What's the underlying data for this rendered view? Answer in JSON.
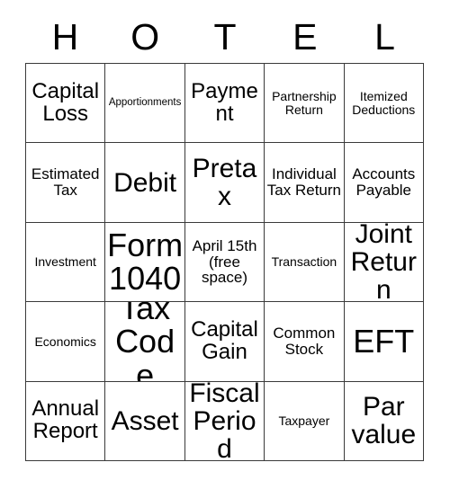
{
  "card": {
    "header_letters": [
      "H",
      "O",
      "T",
      "E",
      "L"
    ],
    "free_space_index": 12,
    "colors": {
      "border": "#3a3a3a",
      "background": "#ffffff",
      "text": "#000000"
    },
    "cells": [
      {
        "text": "Capital Loss",
        "size": "xl"
      },
      {
        "text": "Apportionments",
        "size": "xs"
      },
      {
        "text": "Payment",
        "size": "xl"
      },
      {
        "text": "Partnership Return",
        "size": "s"
      },
      {
        "text": "Itemized Deductions",
        "size": "s"
      },
      {
        "text": "Estimated Tax",
        "size": "m"
      },
      {
        "text": "Debit",
        "size": "xxl"
      },
      {
        "text": "Pretax",
        "size": "xxl"
      },
      {
        "text": "Individual Tax Return",
        "size": "m"
      },
      {
        "text": "Accounts Payable",
        "size": "m"
      },
      {
        "text": "Investment",
        "size": "s"
      },
      {
        "text": "Form 1040",
        "size": "huge"
      },
      {
        "text": "April 15th (free space)",
        "size": "m"
      },
      {
        "text": "Transaction",
        "size": "s"
      },
      {
        "text": "Joint Return",
        "size": "xxl"
      },
      {
        "text": "Economics",
        "size": "s"
      },
      {
        "text": "Tax Code",
        "size": "huge"
      },
      {
        "text": "Capital Gain",
        "size": "xl"
      },
      {
        "text": "Common Stock",
        "size": "m"
      },
      {
        "text": "EFT",
        "size": "huge"
      },
      {
        "text": "Annual Report",
        "size": "xl"
      },
      {
        "text": "Asset",
        "size": "xxl"
      },
      {
        "text": "Fiscal Period",
        "size": "xxl"
      },
      {
        "text": "Taxpayer",
        "size": "s"
      },
      {
        "text": "Par value",
        "size": "xxl"
      }
    ]
  }
}
